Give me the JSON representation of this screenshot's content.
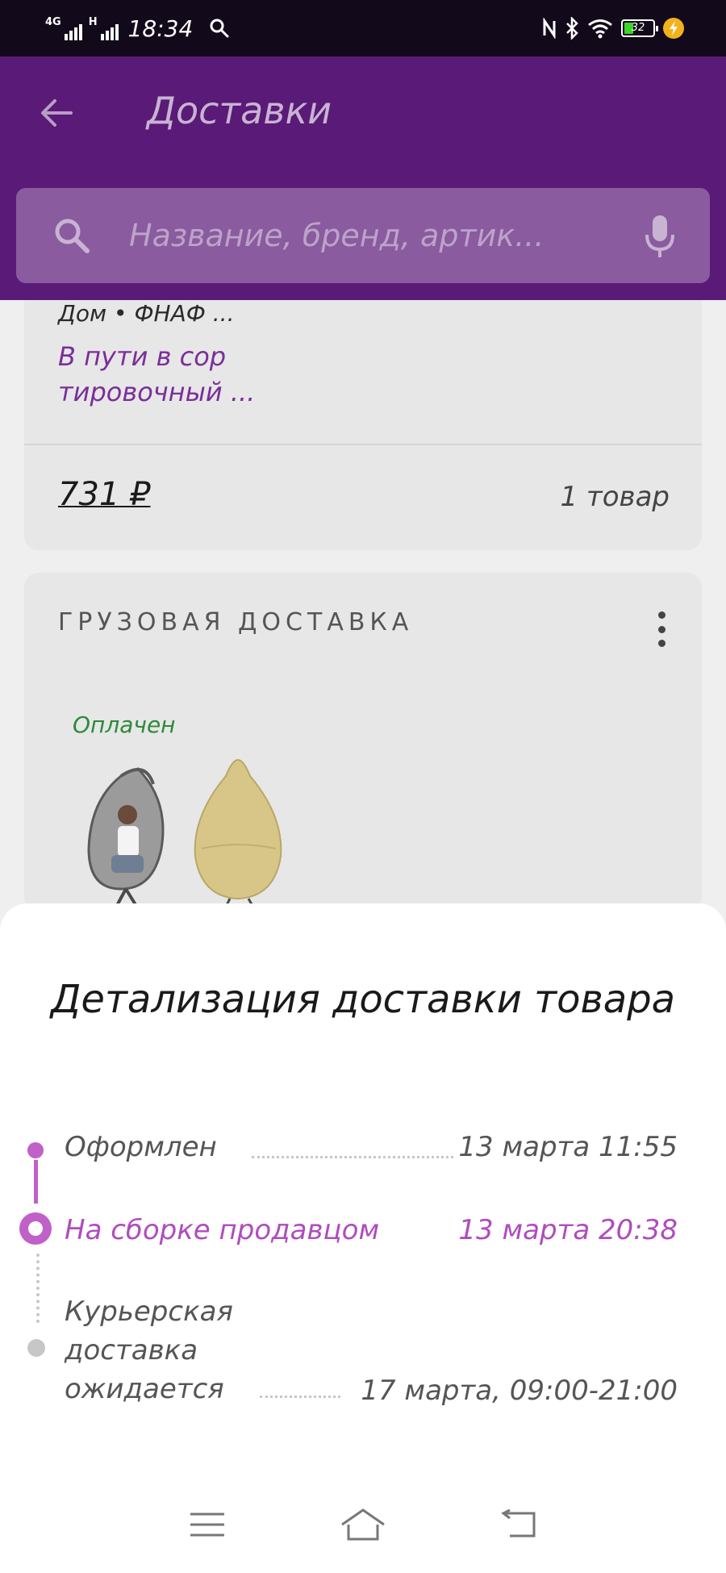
{
  "status_bar": {
    "network_1": "4G",
    "network_2": "H",
    "time": "18:34",
    "battery": "32"
  },
  "header": {
    "title": "Доставки"
  },
  "search": {
    "placeholder": "Название, бренд, артик..."
  },
  "order_card": {
    "store": "Дом • ФНАФ ...",
    "status": "В пути в сор тировочный ...",
    "price": "731 ₽",
    "count": "1 товар"
  },
  "cargo_card": {
    "title": "ГРУЗОВАЯ ДОСТАВКА",
    "payment_status": "Оплачен"
  },
  "sheet": {
    "title": "Детализация доставки товара",
    "steps": [
      {
        "label": "Оформлен",
        "time": "13 марта 11:55",
        "state": "done"
      },
      {
        "label": "На сборке продавцом",
        "time": "13 марта 20:38",
        "state": "current"
      },
      {
        "label": "Курьерская доставка ожидается",
        "time": "17 марта, 09:00-21:00",
        "state": "pending"
      }
    ]
  },
  "colors": {
    "accent": "#c060c9",
    "header": "#5a1a77",
    "paid": "#2e8a3c"
  }
}
